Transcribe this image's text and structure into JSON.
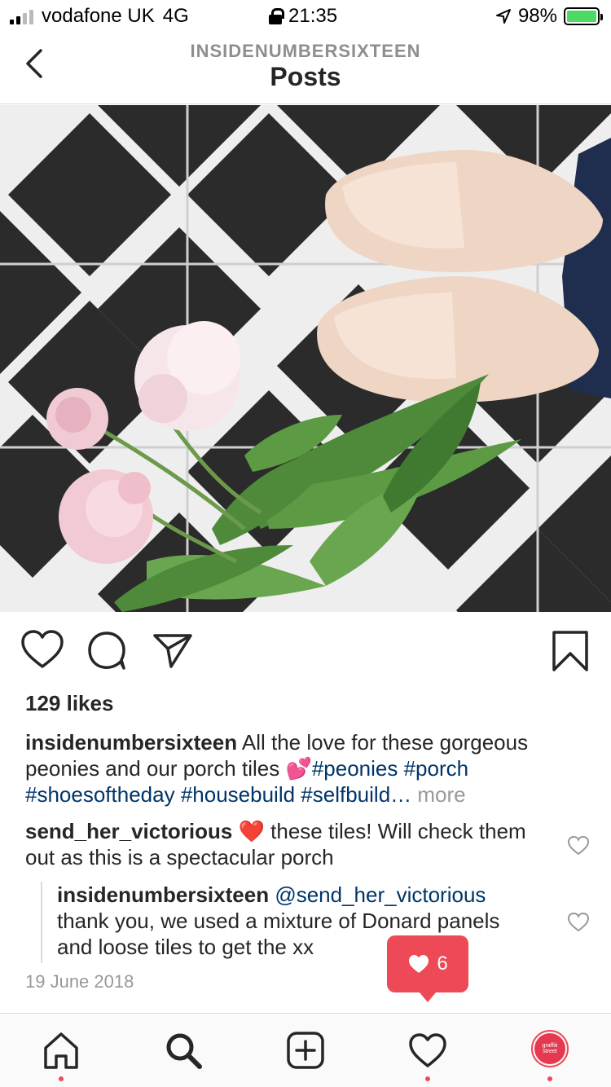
{
  "status_bar": {
    "carrier": "vodafone UK",
    "network": "4G",
    "time": "21:35",
    "battery": "98%"
  },
  "header": {
    "account": "INSIDENUMBERSIXTEEN",
    "title": "Posts"
  },
  "post": {
    "likes": "129 likes",
    "caption": {
      "username": "insidenumbersixteen",
      "text": "All the love for these gorgeous peonies and our porch tiles",
      "emoji": "💕",
      "tags": [
        "#peonies",
        "#porch",
        "#shoesoftheday",
        "#housebuild",
        "#selfbuild…"
      ],
      "more": "more"
    },
    "comments": [
      {
        "username": "send_her_victorious",
        "emoji": "❤️",
        "text": "these tiles! Will check them out as this is a spectacular porch"
      }
    ],
    "reply": {
      "username": "insidenumbersixteen",
      "mention": "@send_her_victorious",
      "text": "thank you, we used a mixture of Donard panels and loose tiles to get the",
      "tail": "xx"
    },
    "date": "19 June 2018"
  },
  "notification": {
    "count": "6"
  },
  "tabs": {
    "items": [
      "home",
      "search",
      "new-post",
      "activity",
      "profile"
    ],
    "avatar_text": "graffiti street"
  },
  "colors": {
    "accent": "#ed4956",
    "link": "#003569",
    "muted": "#8e8e8e"
  }
}
